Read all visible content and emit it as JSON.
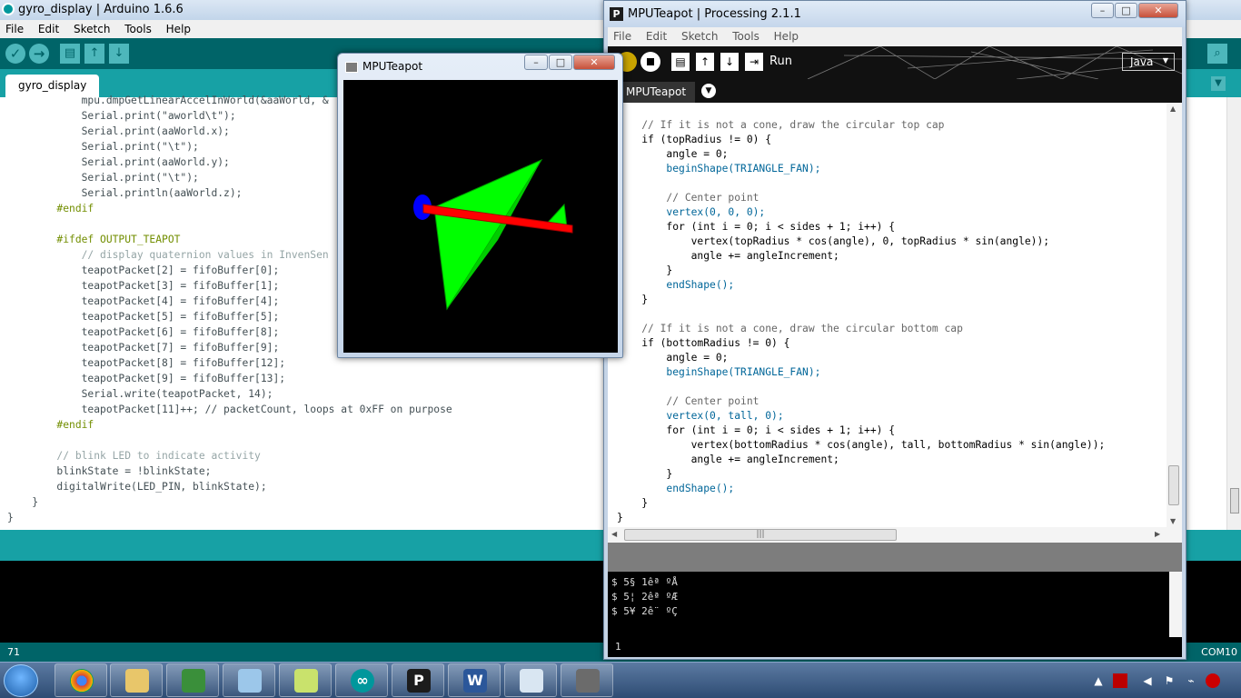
{
  "arduino": {
    "title": "gyro_display | Arduino 1.6.6",
    "menu": [
      "File",
      "Edit",
      "Sketch",
      "Tools",
      "Help"
    ],
    "tab": "gyro_display",
    "code": [
      "            mpu.dmpGetLinearAccelInWorld(&aaWorld, &",
      "            Serial.print(\"aworld\\t\");",
      "            Serial.print(aaWorld.x);",
      "            Serial.print(\"\\t\");",
      "            Serial.print(aaWorld.y);",
      "            Serial.print(\"\\t\");",
      "            Serial.println(aaWorld.z);",
      "        #endif",
      "",
      "        #ifdef OUTPUT_TEAPOT",
      "            // display quaternion values in InvenSen",
      "            teapotPacket[2] = fifoBuffer[0];",
      "            teapotPacket[3] = fifoBuffer[1];",
      "            teapotPacket[4] = fifoBuffer[4];",
      "            teapotPacket[5] = fifoBuffer[5];",
      "            teapotPacket[6] = fifoBuffer[8];",
      "            teapotPacket[7] = fifoBuffer[9];",
      "            teapotPacket[8] = fifoBuffer[12];",
      "            teapotPacket[9] = fifoBuffer[13];",
      "            Serial.write(teapotPacket, 14);",
      "            teapotPacket[11]++; // packetCount, loops at 0xFF on purpose",
      "        #endif",
      "",
      "        // blink LED to indicate activity",
      "        blinkState = !blinkState;",
      "        digitalWrite(LED_PIN, blinkState);",
      "    }",
      "}"
    ],
    "line_number": "71",
    "port": "COM10"
  },
  "processing": {
    "title": "MPUTeapot | Processing 2.1.1",
    "menu": [
      "File",
      "Edit",
      "Sketch",
      "Tools",
      "Help"
    ],
    "run_label": "Run",
    "mode": "Java",
    "tab": "MPUTeapot",
    "code": [
      "    // If it is not a cone, draw the circular top cap",
      "    if (topRadius != 0) {",
      "        angle = 0;",
      "        beginShape(TRIANGLE_FAN);",
      "",
      "        // Center point",
      "        vertex(0, 0, 0);",
      "        for (int i = 0; i < sides + 1; i++) {",
      "            vertex(topRadius * cos(angle), 0, topRadius * sin(angle));",
      "            angle += angleIncrement;",
      "        }",
      "        endShape();",
      "    }",
      "",
      "    // If it is not a cone, draw the circular bottom cap",
      "    if (bottomRadius != 0) {",
      "        angle = 0;",
      "        beginShape(TRIANGLE_FAN);",
      "",
      "        // Center point",
      "        vertex(0, tall, 0);",
      "        for (int i = 0; i < sides + 1; i++) {",
      "            vertex(bottomRadius * cos(angle), tall, bottomRadius * sin(angle));",
      "            angle += angleIncrement;",
      "        }",
      "        endShape();",
      "    }",
      "}"
    ],
    "console": [
      "$ 5§ 1êª ºÅ",
      "$ 5¦ 2êª ºÆ",
      "$ 5¥ 2ê¨ ºÇ"
    ],
    "line_number": "1"
  },
  "teapot_window": {
    "title": "MPUTeapot"
  },
  "taskbar": {
    "apps": [
      "chrome-icon",
      "file-explorer-icon",
      "network-tool-icon",
      "paper-icon",
      "notepad-icon",
      "arduino-icon",
      "processing-icon",
      "word-icon",
      "paint-icon",
      "sketch-window-icon"
    ]
  },
  "colors": {
    "arduino_teal_dark": "#006468",
    "arduino_teal": "#17a1a5",
    "plane_green": "#00ff00",
    "plane_red": "#ff0000",
    "plane_blue": "#0000ff"
  }
}
